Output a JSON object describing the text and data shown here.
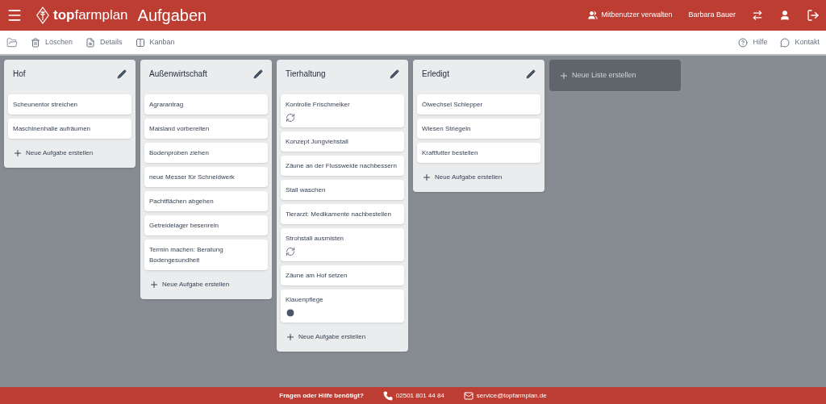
{
  "header": {
    "logo_bold": "top",
    "logo_rest": "farmplan",
    "title": "Aufgaben",
    "manage_users": "Mitbenutzer verwalten",
    "user": "Barbara Bauer"
  },
  "toolbar": {
    "left": [
      {
        "label": "Löschen",
        "kind": "trash"
      },
      {
        "label": "Details",
        "kind": "details"
      },
      {
        "label": "Kanban",
        "kind": "kanban"
      }
    ],
    "right": [
      {
        "label": "Hilfe",
        "kind": "help"
      },
      {
        "label": "Kontakt",
        "kind": "chat"
      }
    ]
  },
  "lists": [
    {
      "title": "Hof",
      "add": "Neue Aufgabe erstellen",
      "cards": [
        {
          "text": "Scheunentor streichen",
          "kind": "plain"
        },
        {
          "text": "Maschinenhalle aufräumen",
          "kind": "plain"
        }
      ]
    },
    {
      "title": "Außenwirtschaft",
      "add": "Neue Aufgabe erstellen",
      "cards": [
        {
          "text": "Agrarantrag",
          "kind": "plain"
        },
        {
          "text": "Maisland vorbereiten",
          "kind": "plain"
        },
        {
          "text": "Bodenproben ziehen",
          "kind": "plain"
        },
        {
          "text": "neue Messer für Schneidwerk",
          "kind": "plain"
        },
        {
          "text": "Pachtflächen abgehen",
          "kind": "plain"
        },
        {
          "text": "Getreidelager besenrein",
          "kind": "plain"
        },
        {
          "text": "Termin machen: Beratung Bodengesundheit",
          "kind": "plain"
        }
      ]
    },
    {
      "title": "Tierhaltung",
      "add": "Neue Aufgabe erstellen",
      "cards": [
        {
          "text": "Kontrolle Frischmelker",
          "kind": "recurring"
        },
        {
          "text": "Konzept Jungviehstall",
          "kind": "plain"
        },
        {
          "text": "Zäune an der Flussweide nachbessern",
          "kind": "plain"
        },
        {
          "text": "Stall waschen",
          "kind": "plain"
        },
        {
          "text": "Tierarzt: Medikamente nachbestellen",
          "kind": "plain"
        },
        {
          "text": "Strohstall ausmisten",
          "kind": "recurring"
        },
        {
          "text": "Zäune am Hof setzen",
          "kind": "plain"
        },
        {
          "text": "Klauenpflege",
          "kind": "scheduled"
        }
      ]
    },
    {
      "title": "Erledigt",
      "add": "Neue Aufgabe erstellen",
      "cards": [
        {
          "text": "Ölwechsel Schlepper",
          "kind": "plain"
        },
        {
          "text": "Wiesen Striegeln",
          "kind": "plain"
        },
        {
          "text": "Kraftfutter bestellen",
          "kind": "plain"
        }
      ]
    }
  ],
  "new_list": "Neue Liste erstellen",
  "footer": {
    "question": "Fragen oder Hilfe benötigt?",
    "phone": "02501 801 44 84",
    "email": "service@topfarmplan.de"
  }
}
